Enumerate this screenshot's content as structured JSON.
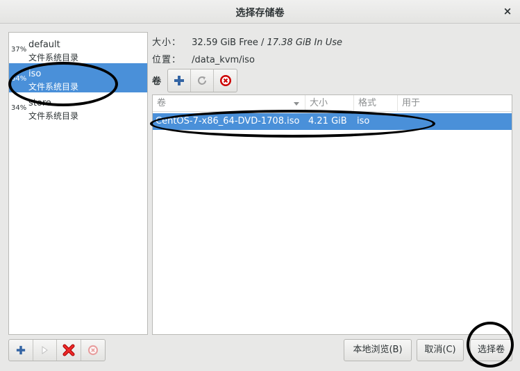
{
  "window": {
    "title": "选择存储卷",
    "close_glyph": "×"
  },
  "pools": [
    {
      "percent": "37%",
      "name": "default",
      "type": "文件系统目录",
      "selected": false
    },
    {
      "percent": "64%",
      "name": "iso",
      "type": "文件系统目录",
      "selected": true
    },
    {
      "percent": "34%",
      "name": "store",
      "type": "文件系统目录",
      "selected": false
    }
  ],
  "details": {
    "size_label": "大小：",
    "size_free": "32.59 GiB Free / ",
    "size_in_use": "17.38 GiB In Use",
    "location_label": "位置：",
    "location_value": "/data_kvm/iso"
  },
  "volumes_label": "卷",
  "volume_table": {
    "columns": [
      "卷",
      "大小",
      "格式",
      "用于"
    ],
    "rows": [
      {
        "name": "CentOS-7-x86_64-DVD-1708.iso",
        "size": "4.21 GiB",
        "format": "iso",
        "used_by": ""
      }
    ]
  },
  "buttons": {
    "browse_local": "本地浏览(B)",
    "cancel": "取消(C)",
    "choose_volume": "选择卷"
  },
  "colors": {
    "selection": "#4a90d9",
    "add": "#3465a4",
    "delete": "#cc0000"
  },
  "icons": {
    "add_volume": "plus-icon",
    "refresh": "refresh-icon",
    "delete_volume": "stop-icon",
    "add_pool": "plus-icon",
    "start_pool": "play-icon",
    "delete_pool": "delete-x-icon",
    "stop_pool": "stop-icon"
  }
}
